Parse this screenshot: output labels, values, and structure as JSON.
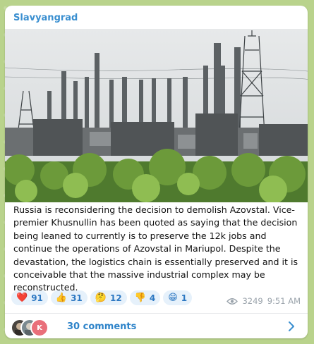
{
  "post": {
    "channel": "Slavyangrad",
    "text": "Russia is reconsidering the decision to demolish Azovstal. Vice-premier Khusnullin has been quoted as saying that the decision being leaned to currently is to preserve the 12k jobs and continue the operations of Azovstal in Mariupol. Despite the devastation, the logistics chain is essentially preserved and it is conceivable that the massive industrial complex may be reconstructed.",
    "views": "3249",
    "time": "9:51 AM",
    "reactions": [
      {
        "emoji": "❤️",
        "count": "91",
        "icon": "heart-icon"
      },
      {
        "emoji": "👍",
        "count": "31",
        "icon": "thumbs-up-icon"
      },
      {
        "emoji": "🤔",
        "count": "12",
        "icon": "thinking-face-icon"
      },
      {
        "emoji": "👎",
        "count": "4",
        "icon": "thumbs-down-icon"
      },
      {
        "emoji": "😁",
        "count": "1",
        "icon": "grinning-face-icon"
      }
    ],
    "comments": {
      "label": "30 comments",
      "avatar_letter": "K"
    }
  },
  "colors": {
    "accent": "#3a8fd0",
    "reaction_bg": "#e6f1fb",
    "background": "#b9d38c"
  }
}
